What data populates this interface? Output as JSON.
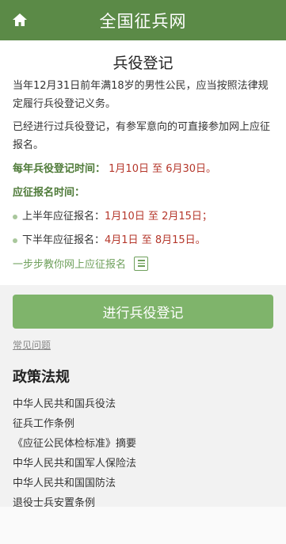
{
  "header": {
    "title": "全国征兵网"
  },
  "card": {
    "heading": "兵役登记",
    "desc1": "当年12月31日前年满18岁的男性公民，应当按照法律规定履行兵役登记义务。",
    "desc2": "已经进行过兵役登记，有参军意向的可直接参加网上应征报名。",
    "registration_label": "每年兵役登记时间：",
    "registration_time": "1月10日 至 6月30日。",
    "apply_label": "应征报名时间：",
    "first_half_label": "上半年应征报名：",
    "first_half_time": "1月10日 至 2月15日；",
    "second_half_label": "下半年应征报名：",
    "second_half_time": "4月1日 至 8月15日。",
    "guide_link": "一步步教你网上应征报名"
  },
  "actions": {
    "register_button": "进行兵役登记",
    "faq_link": "常见问题"
  },
  "policy": {
    "title": "政策法规",
    "items": [
      "中华人民共和国兵役法",
      "征兵工作条例",
      "《应征公民体检标准》摘要",
      "中华人民共和国军人保险法",
      "中华人民共和国国防法",
      "退役士兵安置条例"
    ]
  },
  "colors": {
    "header_bg": "#5b8a47",
    "accent_green": "#4e7a38",
    "date_red": "#b5372b",
    "button_bg": "#7fb46b"
  }
}
